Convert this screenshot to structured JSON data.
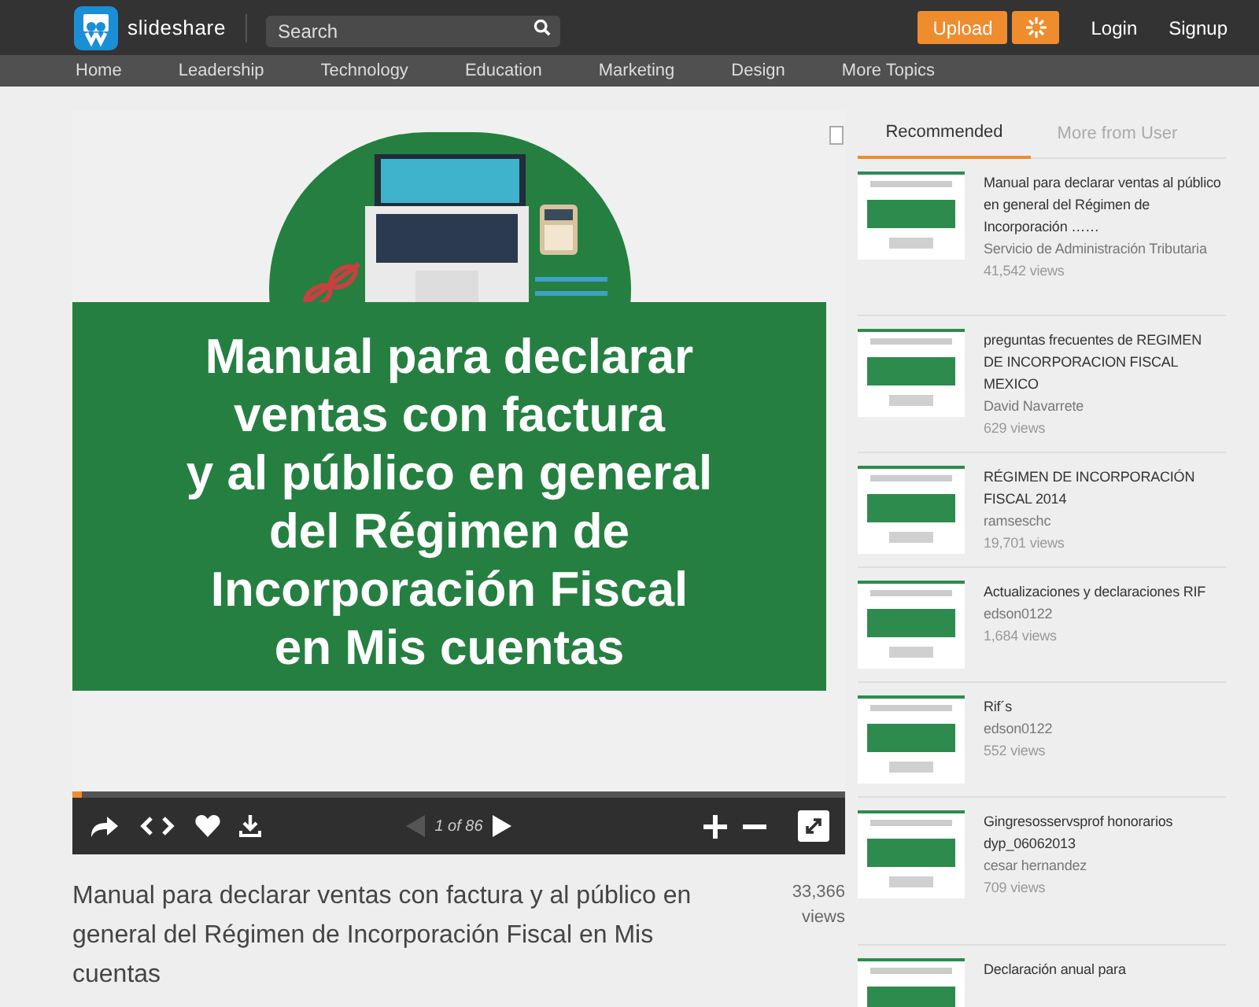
{
  "header": {
    "logo_text": "slideshare",
    "search": {
      "placeholder": "Search"
    },
    "upload": "Upload",
    "login": "Login",
    "signup": "Signup"
  },
  "nav": [
    "Home",
    "Leadership",
    "Technology",
    "Education",
    "Marketing",
    "Design",
    "More Topics"
  ],
  "slide": {
    "lines": [
      "Manual para declarar",
      "ventas con factura",
      "y al público en general",
      "del Régimen de",
      "Incorporación Fiscal",
      "en Mis cuentas"
    ]
  },
  "player": {
    "progress": {
      "level": 0.012
    },
    "page": "1 of 86"
  },
  "document": {
    "title": "Manual para declarar ventas con factura y al público en general del Régimen de Incorporación Fiscal en Mis cuentas",
    "views_count": "33,366",
    "views_label": "views"
  },
  "sidebar": {
    "tabs": [
      {
        "label": "Recommended",
        "selected": true
      },
      {
        "label": "More from User",
        "selected": false
      }
    ],
    "items": [
      {
        "title": "Manual para declarar ventas al público en general del Régimen de Incorporación ……",
        "author": "Servicio de Administración Tributaria",
        "views": "41,542 views"
      },
      {
        "title": "preguntas frecuentes de REGIMEN DE INCORPORACION FISCAL MEXICO",
        "author": "David Navarrete",
        "views": "629 views"
      },
      {
        "title": "RÉGIMEN DE INCORPORACIÓN FISCAL 2014",
        "author": "ramseschc",
        "views": "19,701 views"
      },
      {
        "title": "Actualizaciones y declaraciones RIF",
        "author": "edson0122",
        "views": "1,684 views"
      },
      {
        "title": "Rif´s",
        "author": "edson0122",
        "views": "552 views"
      },
      {
        "title": "Gingresosservsprof honorarios dyp_06062013",
        "author": "cesar hernandez",
        "views": "709 views"
      },
      {
        "title": "Declaración anual para"
      }
    ]
  }
}
